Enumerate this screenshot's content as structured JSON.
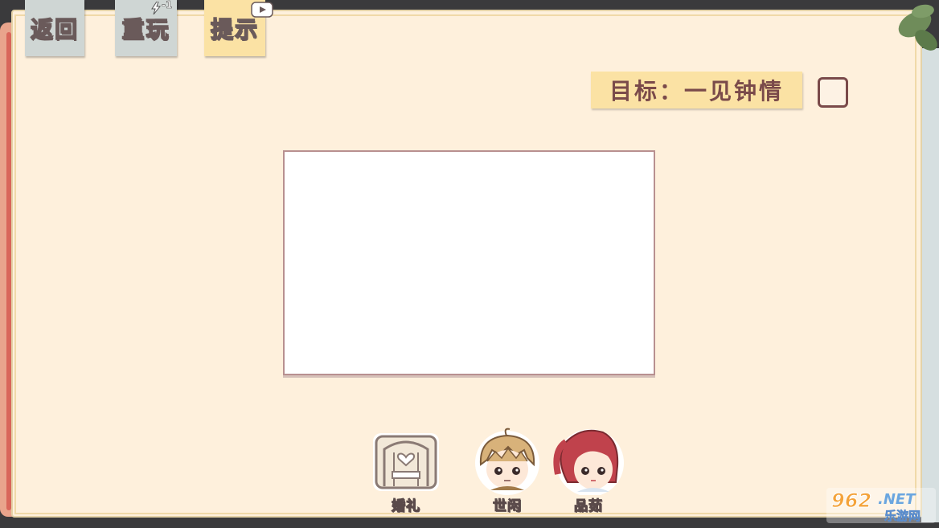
{
  "toolbar": {
    "back_label": "返回",
    "replay_label": "重玩",
    "replay_cost": "-1",
    "hint_label": "提示"
  },
  "goal": {
    "text": "目标：一见钟情",
    "checked": false
  },
  "items": [
    {
      "label": "婚礼",
      "icon": "wedding-chapel-icon"
    },
    {
      "label": "世闲",
      "icon": "boy-character-icon"
    },
    {
      "label": "品茹",
      "icon": "girl-character-icon"
    }
  ],
  "watermark": {
    "number": "962",
    "suffix": ".NET",
    "site_name": "乐游网"
  },
  "colors": {
    "board": "#fef0dc",
    "note_gray": "#cfd6d4",
    "note_yellow": "#fbe2a4",
    "text_brown": "#7a4a4a"
  }
}
